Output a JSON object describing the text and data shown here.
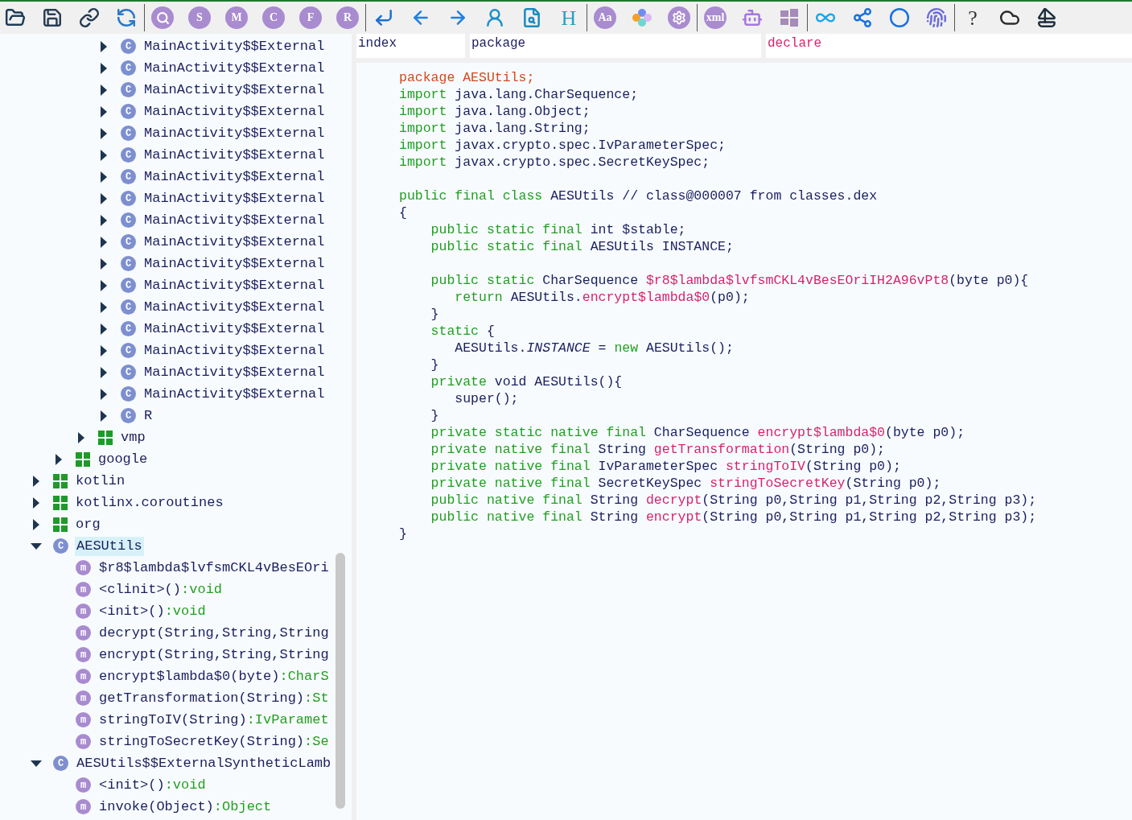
{
  "toolbar": [
    [
      {
        "kind": "open"
      },
      {
        "kind": "save"
      },
      {
        "kind": "link"
      },
      {
        "kind": "sync"
      }
    ],
    [
      {
        "kind": "search"
      },
      {
        "kind": "letter",
        "text": "S"
      },
      {
        "kind": "letter",
        "text": "M"
      },
      {
        "kind": "letter",
        "text": "C"
      },
      {
        "kind": "letter",
        "text": "F"
      },
      {
        "kind": "letter",
        "text": "R"
      }
    ],
    [
      {
        "kind": "jump"
      },
      {
        "kind": "back"
      },
      {
        "kind": "forward"
      },
      {
        "kind": "person"
      },
      {
        "kind": "report"
      },
      {
        "kind": "heading",
        "text": "H"
      }
    ],
    [
      {
        "kind": "letter",
        "text": "Aa"
      },
      {
        "kind": "hexagons"
      },
      {
        "kind": "gear"
      }
    ],
    [
      {
        "kind": "letter",
        "text": "xml"
      },
      {
        "kind": "android"
      },
      {
        "kind": "windows"
      }
    ],
    [
      {
        "kind": "infinity"
      },
      {
        "kind": "share"
      },
      {
        "kind": "ring"
      },
      {
        "kind": "fingerprint"
      }
    ],
    [
      {
        "kind": "help",
        "text": "?"
      },
      {
        "kind": "cloud"
      },
      {
        "kind": "sailboat"
      }
    ]
  ],
  "tree": [
    {
      "children": [
        {
          "children": [
            {
              "children": [
                {
                  "kind": "class",
                  "badge": "C",
                  "label": "MainActivity$$External",
                  "expanded": false
                },
                {
                  "kind": "class",
                  "badge": "C",
                  "label": "MainActivity$$External",
                  "expanded": false
                },
                {
                  "kind": "class",
                  "badge": "C",
                  "label": "MainActivity$$External",
                  "expanded": false
                },
                {
                  "kind": "class",
                  "badge": "C",
                  "label": "MainActivity$$External",
                  "expanded": false
                },
                {
                  "kind": "class",
                  "badge": "C",
                  "label": "MainActivity$$External",
                  "expanded": false
                },
                {
                  "kind": "class",
                  "badge": "C",
                  "label": "MainActivity$$External",
                  "expanded": false
                },
                {
                  "kind": "class",
                  "badge": "C",
                  "label": "MainActivity$$External",
                  "expanded": false
                },
                {
                  "kind": "class",
                  "badge": "C",
                  "label": "MainActivity$$External",
                  "expanded": false
                },
                {
                  "kind": "class",
                  "badge": "C",
                  "label": "MainActivity$$External",
                  "expanded": false
                },
                {
                  "kind": "class",
                  "badge": "C",
                  "label": "MainActivity$$External",
                  "expanded": false
                },
                {
                  "kind": "class",
                  "badge": "C",
                  "label": "MainActivity$$External",
                  "expanded": false
                },
                {
                  "kind": "class",
                  "badge": "C",
                  "label": "MainActivity$$External",
                  "expanded": false
                },
                {
                  "kind": "class",
                  "badge": "C",
                  "label": "MainActivity$$External",
                  "expanded": false
                },
                {
                  "kind": "class",
                  "badge": "C",
                  "label": "MainActivity$$External",
                  "expanded": false
                },
                {
                  "kind": "class",
                  "badge": "C",
                  "label": "MainActivity$$External",
                  "expanded": false
                },
                {
                  "kind": "class",
                  "badge": "C",
                  "label": "MainActivity$$External",
                  "expanded": false
                },
                {
                  "kind": "class",
                  "badge": "C",
                  "label": "MainActivity$$External",
                  "expanded": false
                },
                {
                  "kind": "class",
                  "badge": "C",
                  "label": "R",
                  "expanded": false
                }
              ]
            },
            {
              "kind": "package",
              "label": "vmp",
              "expanded": false
            }
          ]
        },
        {
          "kind": "package",
          "label": "google",
          "expanded": false
        }
      ]
    },
    {
      "kind": "package",
      "label": "kotlin",
      "expanded": false
    },
    {
      "kind": "package",
      "label": "kotlinx.coroutines",
      "expanded": false
    },
    {
      "kind": "package",
      "label": "org",
      "expanded": false
    },
    {
      "kind": "class",
      "badge": "C",
      "label": "AESUtils",
      "expanded": true,
      "selected": true,
      "children": [
        {
          "kind": "method",
          "badge": "m",
          "label": "$r8$lambda$lvfsmCKL4vBesEOri"
        },
        {
          "kind": "method",
          "badge": "m",
          "label": "<clinit>()",
          "type": ":void"
        },
        {
          "kind": "method",
          "badge": "m",
          "label": "<init>()",
          "type": ":void"
        },
        {
          "kind": "method",
          "badge": "m",
          "label": "decrypt(String,String,String"
        },
        {
          "kind": "method",
          "badge": "m",
          "label": "encrypt(String,String,String"
        },
        {
          "kind": "method",
          "badge": "m",
          "label": "encrypt$lambda$0(byte)",
          "type": ":CharS"
        },
        {
          "kind": "method",
          "badge": "m",
          "label": "getTransformation(String)",
          "type": ":St"
        },
        {
          "kind": "method",
          "badge": "m",
          "label": "stringToIV(String)",
          "type": ":IvParamet"
        },
        {
          "kind": "method",
          "badge": "m",
          "label": "stringToSecretKey(String)",
          "type": ":Se"
        }
      ]
    },
    {
      "kind": "class",
      "badge": "C",
      "label": "AESUtils$$ExternalSyntheticLamb",
      "expanded": true,
      "selected": false,
      "children": [
        {
          "kind": "method",
          "badge": "m",
          "label": "<init>()",
          "type": ":void"
        },
        {
          "kind": "method",
          "badge": "m",
          "label": "invoke(Object)",
          "type": ":Object"
        }
      ]
    }
  ],
  "headers": [
    {
      "label": "index",
      "highlighted": false
    },
    {
      "label": "package",
      "highlighted": false
    },
    {
      "label": "declare",
      "highlighted": true
    }
  ],
  "code_blocks": [
    [
      {
        "tokens": [
          {
            "kind": "package",
            "text": "package AESUtils;"
          }
        ]
      },
      {
        "tokens": [
          {
            "kind": "keyword",
            "text": "import"
          },
          {
            "kind": "plain",
            "text": " java.lang.CharSequence;"
          }
        ]
      },
      {
        "tokens": [
          {
            "kind": "keyword",
            "text": "import"
          },
          {
            "kind": "plain",
            "text": " java.lang.Object;"
          }
        ]
      },
      {
        "tokens": [
          {
            "kind": "keyword",
            "text": "import"
          },
          {
            "kind": "plain",
            "text": " java.lang.String;"
          }
        ]
      },
      {
        "tokens": [
          {
            "kind": "keyword",
            "text": "import"
          },
          {
            "kind": "plain",
            "text": " javax.crypto.spec.IvParameterSpec;"
          }
        ]
      },
      {
        "tokens": [
          {
            "kind": "keyword",
            "text": "import"
          },
          {
            "kind": "plain",
            "text": " javax.crypto.spec.SecretKeySpec;"
          }
        ]
      }
    ],
    [
      {
        "tokens": [
          {
            "kind": "keyword",
            "text": "public final class"
          },
          {
            "kind": "plain",
            "text": " AESUtils // class@000007 from classes.dex"
          }
        ]
      },
      {
        "tokens": [
          {
            "kind": "plain",
            "text": "{"
          }
        ]
      },
      {
        "tokens": [
          {
            "kind": "keyword",
            "text": "    public static final"
          },
          {
            "kind": "plain",
            "text": " int $stable;"
          }
        ]
      },
      {
        "tokens": [
          {
            "kind": "keyword",
            "text": "    public static final"
          },
          {
            "kind": "plain",
            "text": " AESUtils INSTANCE;"
          }
        ]
      }
    ],
    [
      {
        "tokens": [
          {
            "kind": "keyword",
            "text": "    public static"
          },
          {
            "kind": "plain",
            "text": " CharSequence "
          },
          {
            "kind": "name",
            "text": "$r8$lambda$lvfsmCKL4vBesEOriIH2A96vPt8"
          },
          {
            "kind": "plain",
            "text": "(byte p0){"
          }
        ]
      },
      {
        "tokens": [
          {
            "kind": "keyword",
            "text": "       return"
          },
          {
            "kind": "plain",
            "text": " AESUtils."
          },
          {
            "kind": "name",
            "text": "encrypt$lambda$0"
          },
          {
            "kind": "plain",
            "text": "(p0);"
          }
        ]
      },
      {
        "tokens": [
          {
            "kind": "plain",
            "text": "    }"
          }
        ]
      },
      {
        "tokens": [
          {
            "kind": "keyword",
            "text": "    static"
          },
          {
            "kind": "plain",
            "text": " {"
          }
        ]
      },
      {
        "tokens": [
          {
            "kind": "plain",
            "text": "       AESUtils."
          },
          {
            "kind": "field",
            "text": "INSTANCE"
          },
          {
            "kind": "plain",
            "text": " = "
          },
          {
            "kind": "keyword",
            "text": "new"
          },
          {
            "kind": "plain",
            "text": " AESUtils();"
          }
        ]
      },
      {
        "tokens": [
          {
            "kind": "plain",
            "text": "    }"
          }
        ]
      },
      {
        "tokens": [
          {
            "kind": "keyword",
            "text": "    private"
          },
          {
            "kind": "plain",
            "text": " void AESUtils(){"
          }
        ]
      },
      {
        "tokens": [
          {
            "kind": "plain",
            "text": "       super();"
          }
        ]
      },
      {
        "tokens": [
          {
            "kind": "plain",
            "text": "    }"
          }
        ]
      },
      {
        "tokens": [
          {
            "kind": "keyword",
            "text": "    private static native final"
          },
          {
            "kind": "plain",
            "text": " CharSequence "
          },
          {
            "kind": "name",
            "text": "encrypt$lambda$0"
          },
          {
            "kind": "plain",
            "text": "(byte p0);"
          }
        ]
      },
      {
        "tokens": [
          {
            "kind": "keyword",
            "text": "    private native final"
          },
          {
            "kind": "plain",
            "text": " String "
          },
          {
            "kind": "name",
            "text": "getTransformation"
          },
          {
            "kind": "plain",
            "text": "(String p0);"
          }
        ]
      },
      {
        "tokens": [
          {
            "kind": "keyword",
            "text": "    private native final"
          },
          {
            "kind": "plain",
            "text": " IvParameterSpec "
          },
          {
            "kind": "name",
            "text": "stringToIV"
          },
          {
            "kind": "plain",
            "text": "(String p0);"
          }
        ]
      },
      {
        "tokens": [
          {
            "kind": "keyword",
            "text": "    private native final"
          },
          {
            "kind": "plain",
            "text": " SecretKeySpec "
          },
          {
            "kind": "name",
            "text": "stringToSecretKey"
          },
          {
            "kind": "plain",
            "text": "(String p0);"
          }
        ]
      },
      {
        "tokens": [
          {
            "kind": "keyword",
            "text": "    public native final"
          },
          {
            "kind": "plain",
            "text": " String "
          },
          {
            "kind": "name",
            "text": "decrypt"
          },
          {
            "kind": "plain",
            "text": "(String p0,String p1,String p2,String p3);"
          }
        ]
      },
      {
        "tokens": [
          {
            "kind": "keyword",
            "text": "    public native final"
          },
          {
            "kind": "plain",
            "text": " String "
          },
          {
            "kind": "name",
            "text": "encrypt"
          },
          {
            "kind": "plain",
            "text": "(String p0,String p1,String p2,String p3);"
          }
        ]
      },
      {
        "tokens": [
          {
            "kind": "plain",
            "text": "}"
          }
        ]
      }
    ]
  ]
}
